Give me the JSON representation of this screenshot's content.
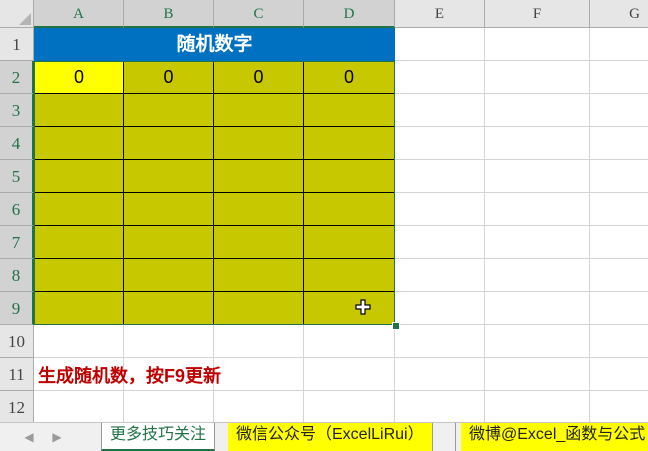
{
  "columns": [
    "A",
    "B",
    "C",
    "D",
    "E",
    "F",
    "G"
  ],
  "rows": [
    "1",
    "2",
    "3",
    "4",
    "5",
    "6",
    "7",
    "8",
    "9",
    "10",
    "11",
    "12"
  ],
  "title_cell": "随机数字",
  "row2_values": [
    "0",
    "0",
    "0",
    "0"
  ],
  "note": "生成随机数，按F9更新",
  "tabs": [
    {
      "label": "更多技巧关注"
    },
    {
      "label": "微信公众号（ExcelLiRui）"
    },
    {
      "label": "微博@Excel_函数与公式"
    }
  ],
  "colors": {
    "title_bg": "#0070c0",
    "data_fill": "#c8c800",
    "active_cell": "#ffff00",
    "note_text": "#c00000",
    "excel_green": "#217346"
  }
}
